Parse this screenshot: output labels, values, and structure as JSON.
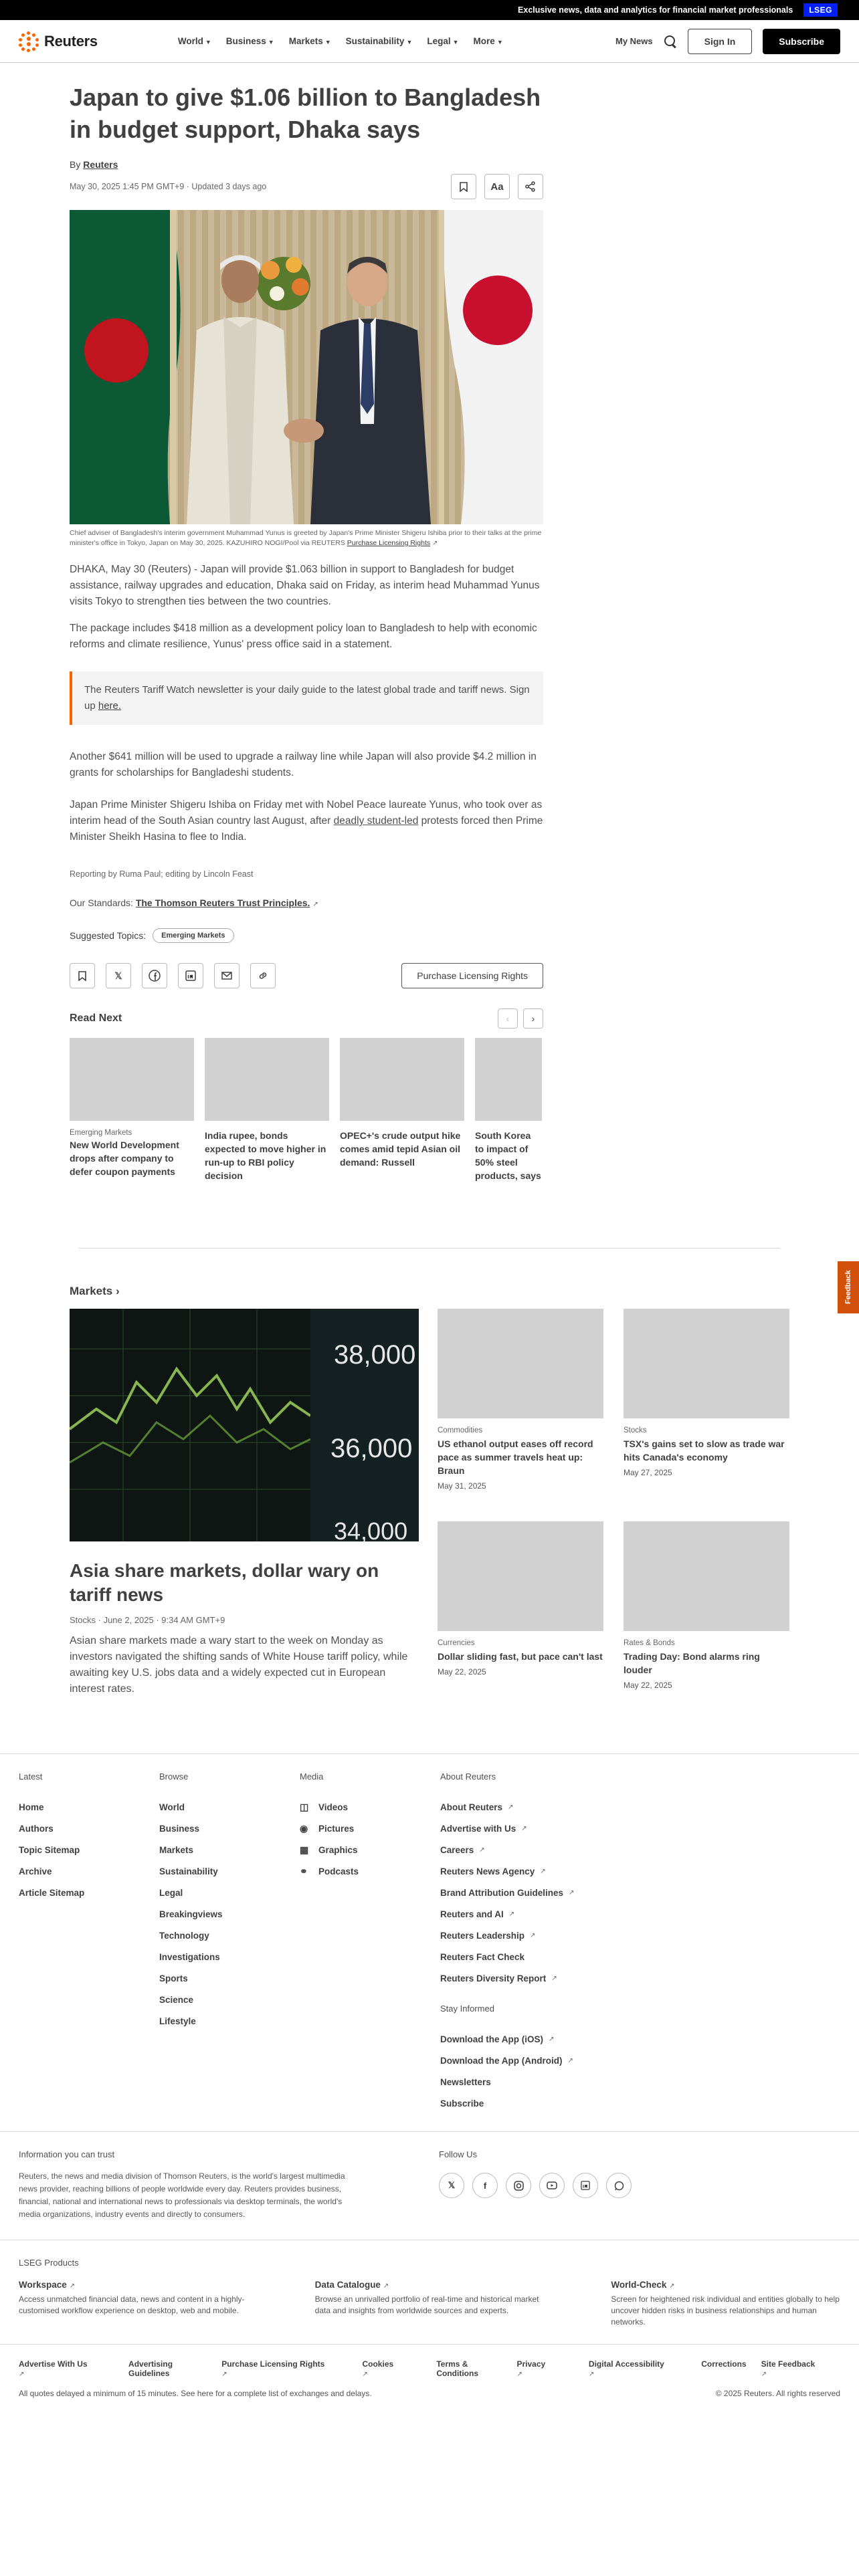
{
  "promo": {
    "text": "Exclusive news, data and analytics for financial market professionals",
    "badge": "LSEG"
  },
  "header": {
    "logo": "Reuters",
    "nav": [
      "World",
      "Business",
      "Markets",
      "Sustainability",
      "Legal",
      "More"
    ],
    "my_news": "My News",
    "sign_in": "Sign In",
    "subscribe": "Subscribe"
  },
  "article": {
    "headline": "Japan to give $1.06 billion to Bangladesh in budget support, Dhaka says",
    "by": "By",
    "author": "Reuters",
    "dateline": "May 30, 2025 1:45 PM GMT+9 · Updated 3 days ago",
    "font_tool": "Aa",
    "caption": "Chief adviser of Bangladesh's interim government Muhammad Yunus is greeted by Japan's Prime Minister Shigeru Ishiba prior to their talks at the prime minister's office in Tokyo, Japan on May 30, 2025. KAZUHIRO NOGI/Pool via REUTERS",
    "caption_link": "Purchase Licensing Rights",
    "paragraphs": [
      "DHAKA, May 30 (Reuters) - Japan will provide $1.063 billion in support to Bangladesh for budget assistance, railway upgrades and education, Dhaka said on Friday, as interim head Muhammad Yunus visits Tokyo to strengthen ties between the two countries.",
      "The package includes $418 million as a development policy loan to Bangladesh to help with economic reforms and climate resilience, Yunus' press office said in a statement."
    ],
    "newsletter": "The Reuters Tariff Watch newsletter is your daily guide to the latest global trade and tariff news. Sign up",
    "newsletter_link": "here.",
    "paragraphs2": [
      "Another $641 million will be used to upgrade a railway line while Japan will also provide $4.2 million in grants for scholarships for Bangladeshi students."
    ],
    "para3_pre": "Japan Prime Minister Shigeru Ishiba on Friday met with Nobel Peace laureate Yunus, who took over as interim head of the South Asian country last August, after",
    "para3_link": "deadly student-led",
    "para3_post": "protests forced then Prime Minister Sheikh Hasina to flee to India.",
    "reporting": "Reporting by Ruma Paul; editing by Lincoln Feast",
    "standards_label": "Our Standards:",
    "standards_link": "The Thomson Reuters Trust Principles.",
    "topics_label": "Suggested Topics:",
    "topic": "Emerging Markets",
    "licensing": "Purchase Licensing Rights"
  },
  "read_next": {
    "title": "Read Next",
    "items": [
      {
        "kicker": "Emerging Markets",
        "headline": "New World Development drops after company to defer coupon payments"
      },
      {
        "kicker": "",
        "headline": "India rupee, bonds expected to move higher in run-up to RBI policy decision"
      },
      {
        "kicker": "",
        "headline": "OPEC+'s crude output hike comes amid tepid Asian oil demand: Russell"
      },
      {
        "kicker": "",
        "headline": "South Korea to impact of 50% steel products, says"
      }
    ]
  },
  "markets": {
    "title": "Markets",
    "board_numbers": [
      "38,000",
      "36,000",
      "34,000"
    ],
    "main": {
      "headline": "Asia share markets, dollar wary on tariff news",
      "meta": "Stocks · June 2, 2025 · 9:34 AM GMT+9",
      "desc": "Asian share markets made a wary start to the week on Monday as investors navigated the shifting sands of White House tariff policy, while awaiting key U.S. jobs data and a widely expected cut in European interest rates."
    },
    "cards": [
      {
        "kicker": "Commodities",
        "headline": "US ethanol output eases off record pace as summer travels heat up: Braun",
        "date": "May 31, 2025"
      },
      {
        "kicker": "Stocks",
        "headline": "TSX's gains set to slow as trade war hits Canada's economy",
        "date": "May 27, 2025"
      },
      {
        "kicker": "Currencies",
        "headline": "Dollar sliding fast, but pace can't last",
        "date": "May 22, 2025"
      },
      {
        "kicker": "Rates & Bonds",
        "headline": "Trading Day: Bond alarms ring louder",
        "date": "May 22, 2025"
      }
    ]
  },
  "feedback": "Feedback",
  "footer": {
    "latest": {
      "title": "Latest",
      "links": [
        "Home",
        "Authors",
        "Topic Sitemap",
        "Archive",
        "Article Sitemap"
      ]
    },
    "browse": {
      "title": "Browse",
      "links": [
        "World",
        "Business",
        "Markets",
        "Sustainability",
        "Legal",
        "Breakingviews",
        "Technology",
        "Investigations",
        "Sports",
        "Science",
        "Lifestyle"
      ]
    },
    "media": {
      "title": "Media",
      "links": [
        "Videos",
        "Pictures",
        "Graphics",
        "Podcasts"
      ]
    },
    "about": {
      "title": "About Reuters",
      "links": [
        "About Reuters",
        "Advertise with Us",
        "Careers",
        "Reuters News Agency",
        "Brand Attribution Guidelines",
        "Reuters and AI",
        "Reuters Leadership",
        "Reuters Fact Check",
        "Reuters Diversity Report"
      ]
    },
    "stay": {
      "title": "Stay Informed",
      "links": [
        "Download the App (iOS)",
        "Download the App (Android)",
        "Newsletters",
        "Subscribe"
      ]
    },
    "trust_title": "Information you can trust",
    "trust_text": "Reuters, the news and media division of Thomson Reuters, is the world's largest multimedia news provider, reaching billions of people worldwide every day. Reuters provides business, financial, national and international news to professionals via desktop terminals, the world's media organizations, industry events and directly to consumers.",
    "follow_title": "Follow Us",
    "lseg_title": "LSEG Products",
    "lseg": [
      {
        "title": "Workspace",
        "desc": "Access unmatched financial data, news and content in a highly-customised workflow experience on desktop, web and mobile."
      },
      {
        "title": "Data Catalogue",
        "desc": "Browse an unrivalled portfolio of real-time and historical market data and insights from worldwide sources and experts."
      },
      {
        "title": "World-Check",
        "desc": "Screen for heightened risk individual and entities globally to help uncover hidden risks in business relationships and human networks."
      }
    ],
    "bottom_left": [
      "Advertise With Us",
      "Advertising Guidelines",
      "Purchase Licensing Rights"
    ],
    "bottom_right": [
      "Cookies",
      "Terms & Conditions",
      "Privacy",
      "Digital Accessibility",
      "Corrections",
      "Site Feedback"
    ],
    "delay_note": "All quotes delayed a minimum of 15 minutes. See here for a complete list of exchanges and delays.",
    "copyright": "© 2025 Reuters. All rights reserved"
  }
}
